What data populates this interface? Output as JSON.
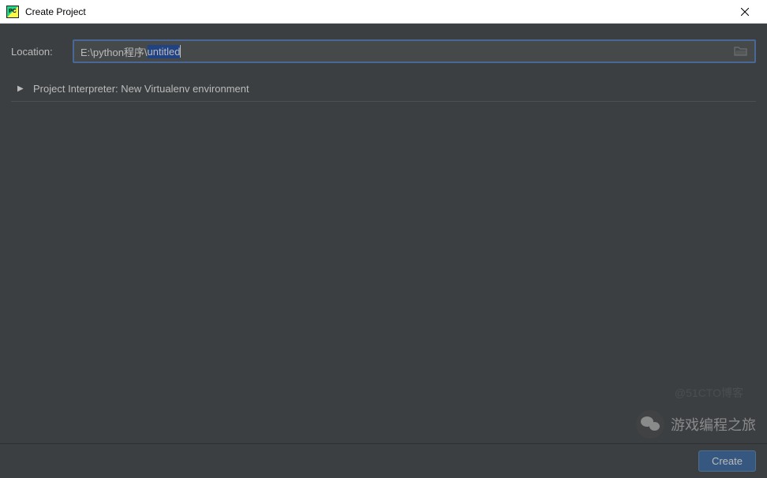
{
  "window": {
    "title": "Create Project"
  },
  "location": {
    "label": "Location:",
    "path_prefix": "E:\\python程序\\",
    "path_selected": "untitled"
  },
  "interpreter": {
    "label": "Project Interpreter: New Virtualenv environment"
  },
  "buttons": {
    "create": "Create"
  },
  "watermark": {
    "text": "游戏编程之旅",
    "faint": "@51CTO博客"
  }
}
